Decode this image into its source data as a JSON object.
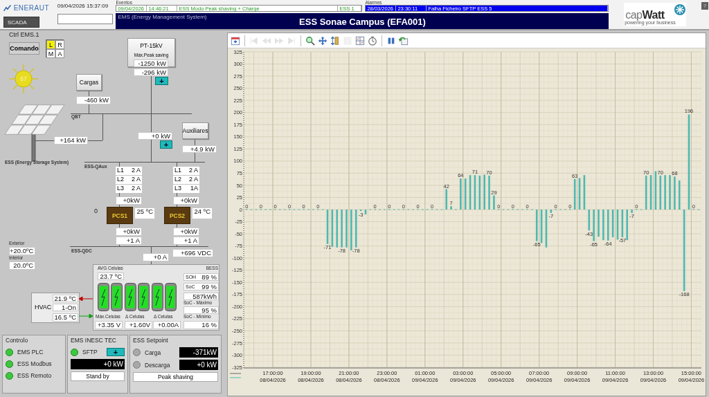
{
  "header": {
    "brand": "ENERAUT",
    "datetime": "09/04/2026 15:37:09",
    "scada_button": "SCADA",
    "help_button": "?",
    "partner_logo": {
      "name": "cap**Watt**",
      "tagline": "powering your business"
    }
  },
  "events": {
    "label": "Eventos",
    "row": [
      "09/04/2026",
      "14:46:21",
      "ESS Modo Peak shaving + Charge",
      "ESS 1"
    ]
  },
  "alarms": {
    "label": "Alarmes",
    "row": [
      "28/03/2026",
      "23:30:11",
      "Falha Ficheiro SFTP ESS 5"
    ]
  },
  "title_bar": {
    "subtitle": "EMS (Energy Management System)",
    "title": "ESS Sonae Campus (EFA001)"
  },
  "control": {
    "title": "Ctrl EMS.1",
    "command_button": "Comando",
    "modes": [
      {
        "label": "L",
        "selected": true
      },
      {
        "label": "R",
        "selected": false
      },
      {
        "label": "M",
        "selected": false
      },
      {
        "label": "A",
        "selected": false
      }
    ]
  },
  "sun": {
    "value": "67"
  },
  "diagram": {
    "pt": {
      "title": "PT-15kV",
      "subtitle": "Máx.Peak saving",
      "limit": "-1250 kW",
      "power": "-296 kW",
      "button": "+"
    },
    "loads": {
      "title": "Cargas",
      "power": "-460 kW"
    },
    "qbt_label": "QBT",
    "pv_power": "+164 kW",
    "ess_label": "ESS (Energy Storage System)",
    "feeder": {
      "power": "+0 kW",
      "button": "+"
    },
    "aux": {
      "title": "Auxiliares",
      "power": "+4.9 kW"
    },
    "qaux_label": "ESS-QAux",
    "pcs_index": "0",
    "pcs": [
      {
        "name": "PCS1",
        "currents": [
          {
            "phase": "L1",
            "value": "2 A"
          },
          {
            "phase": "L2",
            "value": "2 A"
          },
          {
            "phase": "L3",
            "value": "2 A"
          }
        ],
        "ac_power": "+0kW",
        "temperature": "25 ºC",
        "dc_power": "+0kW",
        "dc_current": "+1 A"
      },
      {
        "name": "PCS2",
        "currents": [
          {
            "phase": "L1",
            "value": "2 A"
          },
          {
            "phase": "L2",
            "value": "2 A"
          },
          {
            "phase": "L3",
            "value": "1A"
          }
        ],
        "ac_power": "+0kW",
        "temperature": "24 ºC",
        "dc_power": "+0kW",
        "dc_current": "+1 A"
      }
    ],
    "qdc_label": "ESS-QDC",
    "dc_current": "+0 A",
    "dc_voltage": "+696 VDC",
    "exterior_label": "Exterior",
    "exterior": "+20.0ºC",
    "interior_label": "Interior",
    "interior": "20.0ºC",
    "hvac": {
      "label": "HVAC",
      "supply": "21.9 ºC",
      "state": "1-On",
      "return": "16.5 ºC"
    },
    "bess": {
      "title": "BESS",
      "avg_label": "AVG Celulas",
      "avg": "23.7 ºC",
      "modules": [
        {
          "level": 1
        },
        {
          "level": 1
        },
        {
          "level": 1
        },
        {
          "level": 1
        },
        {
          "level": 1
        },
        {
          "level": 1
        }
      ],
      "soh_label": "SOH",
      "soh": "89 %",
      "soc_label": "SoC",
      "soc": "99 %",
      "energy": "587kWh",
      "soc_max_label": "SoC - Máximo",
      "soc_max": "95 %",
      "soc_min_label": "SoC - Mínimo",
      "soc_min": "16 %",
      "stats": [
        {
          "label": "Máx.Celulas",
          "value": "+3.35 V"
        },
        {
          "label": "Δ Celulas",
          "value": "+1.60V"
        },
        {
          "label": "Δ Celulas",
          "value": "+0.00A"
        }
      ]
    }
  },
  "controlo": {
    "title": "Controlo",
    "indicators": [
      {
        "label": "EMS PLC",
        "on": true
      },
      {
        "label": "ESS Modbus",
        "on": true
      },
      {
        "label": "ESS Remoto",
        "on": true
      }
    ]
  },
  "inesc": {
    "title": "EMS INESC TEC",
    "indicator": {
      "label": "SFTP",
      "on": true
    },
    "button": "+",
    "power": "+0 kW",
    "status": "Stand by"
  },
  "setpoint": {
    "title": "ESS Setpoint",
    "rows": [
      {
        "label": "Carga",
        "on": false,
        "value": "-371kW"
      },
      {
        "label": "Descarga",
        "on": false,
        "value": "+0 kW"
      }
    ],
    "mode": "Peak shaving"
  },
  "toolbar_groups": [
    [
      {
        "kind": "calendar",
        "disabled": false
      }
    ],
    [
      {
        "kind": "first",
        "disabled": true
      },
      {
        "kind": "rewind",
        "disabled": true
      },
      {
        "kind": "forward",
        "disabled": true
      },
      {
        "kind": "last",
        "disabled": true
      }
    ],
    [
      {
        "kind": "zoom",
        "disabled": false
      },
      {
        "kind": "pan",
        "disabled": false
      },
      {
        "kind": "vscale",
        "disabled": false
      },
      {
        "kind": "frame",
        "disabled": true
      },
      {
        "kind": "grid",
        "disabled": false
      },
      {
        "kind": "clock",
        "disabled": false
      }
    ],
    [
      {
        "kind": "pause",
        "disabled": false
      },
      {
        "kind": "undo",
        "disabled": false
      }
    ]
  ],
  "chart": {
    "chart_data": {
      "type": "bar",
      "categories": [
        null,
        null,
        null,
        null,
        null,
        null,
        "17:00:00 08/04/2026",
        null,
        null,
        null,
        null,
        null,
        null,
        null,
        "19:00:00 08/04/2026",
        null,
        null,
        null,
        null,
        null,
        null,
        null,
        "21:00:00 08/04/2026",
        null,
        null,
        null,
        null,
        null,
        null,
        null,
        "23:00:00 08/04/2026",
        null,
        null,
        null,
        null,
        null,
        null,
        null,
        "01:00:00 09/04/2026",
        null,
        null,
        null,
        null,
        null,
        null,
        null,
        "03:00:00 09/04/2026",
        null,
        null,
        null,
        null,
        null,
        null,
        null,
        "05:00:00 09/04/2026",
        null,
        null,
        null,
        null,
        null,
        null,
        null,
        "07:00:00 09/04/2026",
        null,
        null,
        null,
        null,
        null,
        null,
        null,
        "09:00:00 09/04/2026",
        null,
        null,
        null,
        null,
        null,
        null,
        null,
        "11:00:00 09/04/2026",
        null,
        null,
        null,
        null,
        null,
        null,
        null,
        "13:00:00 09/04/2026",
        null,
        null,
        null,
        null,
        null,
        null,
        null,
        "15:00:00 09/04/2026",
        null
      ],
      "series": [
        {
          "color": "#4fb8b0",
          "values": [
            0,
            0,
            0,
            0,
            0,
            0,
            0,
            0,
            0,
            0,
            0,
            0,
            0,
            0,
            0,
            0,
            0,
            -71,
            -77,
            -78,
            -78,
            -78,
            -84,
            -78,
            -3,
            -10,
            0,
            0,
            0,
            0,
            0,
            0,
            0,
            0,
            0,
            0,
            0,
            0,
            0,
            0,
            0,
            0,
            42,
            7,
            0,
            64,
            64,
            71,
            71,
            70,
            72,
            70,
            29,
            0,
            0,
            0,
            0,
            0,
            0,
            0,
            0,
            -65,
            -69,
            -78,
            -7,
            0,
            0,
            0,
            0,
            63,
            65,
            71,
            -43,
            -65,
            -56,
            -63,
            -64,
            -57,
            -62,
            -57,
            -63,
            -7,
            0,
            0,
            70,
            71,
            79,
            70,
            71,
            71,
            68,
            60,
            -168,
            196,
            0,
            0
          ]
        }
      ],
      "value_labels": [
        "0",
        null,
        null,
        "0",
        null,
        null,
        "0",
        null,
        null,
        "0",
        null,
        null,
        "0",
        null,
        null,
        "0",
        null,
        "-71",
        null,
        null,
        "-78",
        null,
        null,
        "-78",
        "-3",
        null,
        null,
        "0",
        null,
        null,
        "0",
        null,
        null,
        "0",
        null,
        null,
        "0",
        null,
        null,
        "0",
        null,
        null,
        "42",
        "7",
        null,
        "64",
        null,
        null,
        "71",
        null,
        null,
        "70",
        "29",
        "0",
        null,
        null,
        "0",
        null,
        null,
        "0",
        null,
        "-65",
        null,
        null,
        "-7",
        "0",
        null,
        null,
        "0",
        "63",
        null,
        null,
        "-43",
        "-65",
        null,
        null,
        "-64",
        null,
        null,
        "-57",
        null,
        "-7",
        "0",
        null,
        "70",
        null,
        null,
        "70",
        null,
        null,
        "68",
        null,
        "-168",
        "196",
        "0",
        null
      ],
      "grid": true,
      "ylim": [
        -325,
        325
      ],
      "yticks": [
        -325,
        -300,
        -275,
        -250,
        -225,
        -200,
        -175,
        -150,
        -125,
        -100,
        -75,
        -50,
        -25,
        0,
        25,
        50,
        75,
        100,
        125,
        150,
        175,
        200,
        225,
        250,
        275,
        300,
        325
      ]
    }
  }
}
